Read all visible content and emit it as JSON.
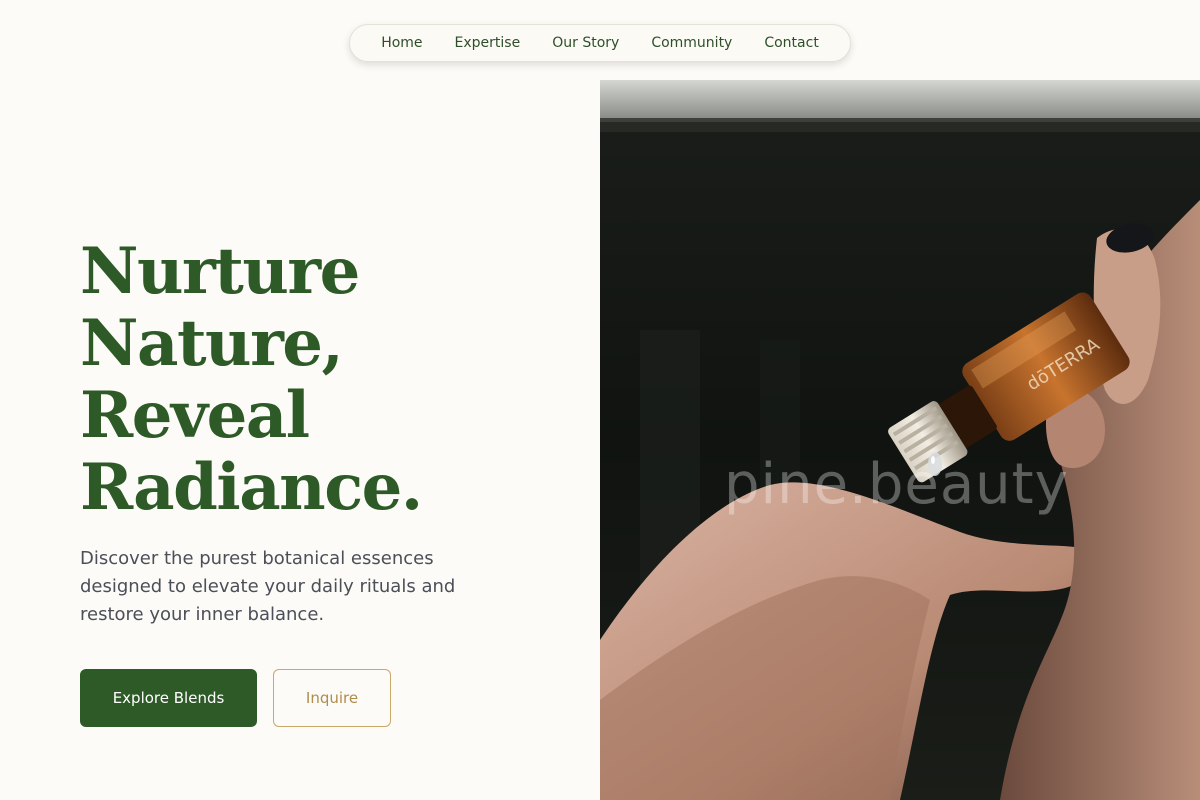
{
  "nav": {
    "items": [
      {
        "label": "Home"
      },
      {
        "label": "Expertise"
      },
      {
        "label": "Our Story"
      },
      {
        "label": "Community"
      },
      {
        "label": "Contact"
      }
    ]
  },
  "hero": {
    "title_lines": [
      "Nurture",
      "Nature,",
      "Reveal",
      "Radiance."
    ],
    "description": "Discover the purest botanical essences designed to elevate your daily rituals and restore your inner balance.",
    "primary_button": "Explore Blends",
    "secondary_button": "Inquire"
  },
  "image": {
    "watermark": "pine.beauty",
    "bottle_label": "dōTERRA"
  },
  "colors": {
    "accent_green": "#2d5a27",
    "gold": "#b08d4c",
    "background": "#fcfbf7"
  }
}
